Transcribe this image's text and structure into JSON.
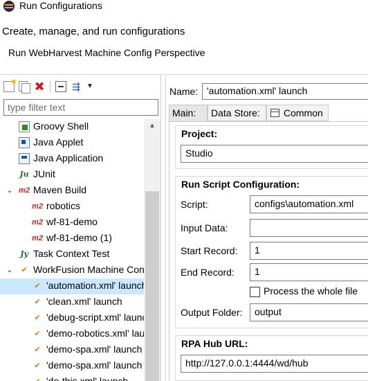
{
  "window": {
    "title": "Run Configurations"
  },
  "header": {
    "heading": "Create, manage, and run configurations",
    "subheading": "Run WebHarvest Machine Config Perspective"
  },
  "toolbar": {
    "new_icon": "new-config-icon",
    "duplicate_icon": "duplicate-icon",
    "delete_icon": "delete-icon",
    "collapse_icon": "collapse-all-icon",
    "filter_icon": "filter-icon",
    "menu_icon": "view-menu-icon",
    "delete_glyph": "✖",
    "filter_glyph": "⇶",
    "menu_glyph": "▼"
  },
  "filter": {
    "placeholder": "type filter text"
  },
  "tree": {
    "items": [
      {
        "label": "Groovy Shell",
        "level": 1,
        "icon": "groovy-icon",
        "expanded": null,
        "selected": false
      },
      {
        "label": "Java Applet",
        "level": 1,
        "icon": "java-applet-icon",
        "expanded": null,
        "selected": false
      },
      {
        "label": "Java Application",
        "level": 1,
        "icon": "java-app-icon",
        "expanded": null,
        "selected": false
      },
      {
        "label": "JUnit",
        "level": 1,
        "icon": "junit-icon",
        "expanded": null,
        "selected": false
      },
      {
        "label": "Maven Build",
        "level": 1,
        "icon": "maven-icon",
        "expanded": true,
        "selected": false
      },
      {
        "label": "robotics",
        "level": 2,
        "icon": "maven-icon",
        "expanded": null,
        "selected": false
      },
      {
        "label": "wf-81-demo",
        "level": 2,
        "icon": "maven-icon",
        "expanded": null,
        "selected": false
      },
      {
        "label": "wf-81-demo (1)",
        "level": 2,
        "icon": "maven-icon",
        "expanded": null,
        "selected": false
      },
      {
        "label": "Task Context Test",
        "level": 1,
        "icon": "task-context-icon",
        "expanded": null,
        "selected": false
      },
      {
        "label": "WorkFusion Machine Config",
        "level": 1,
        "icon": "workfusion-icon",
        "expanded": true,
        "selected": false
      },
      {
        "label": "'automation.xml' launch",
        "level": 2,
        "icon": "workfusion-icon",
        "expanded": null,
        "selected": true
      },
      {
        "label": "'clean.xml' launch",
        "level": 2,
        "icon": "workfusion-icon",
        "expanded": null,
        "selected": false
      },
      {
        "label": "'debug-script.xml' launch",
        "level": 2,
        "icon": "workfusion-icon",
        "expanded": null,
        "selected": false
      },
      {
        "label": "'demo-robotics.xml' launch",
        "level": 2,
        "icon": "workfusion-icon",
        "expanded": null,
        "selected": false
      },
      {
        "label": "'demo-spa.xml' launch",
        "level": 2,
        "icon": "workfusion-icon",
        "expanded": null,
        "selected": false
      },
      {
        "label": "'demo-spa.xml' launch",
        "level": 2,
        "icon": "workfusion-icon",
        "expanded": null,
        "selected": false
      },
      {
        "label": "'do-this.xml' launch",
        "level": 2,
        "icon": "workfusion-icon",
        "expanded": null,
        "selected": false
      }
    ]
  },
  "editor": {
    "name_label": "Name:",
    "name_value": "'automation.xml' launch",
    "tabs": [
      {
        "label": "Main:",
        "active": true
      },
      {
        "label": "Data Store:",
        "active": false
      },
      {
        "label": "Common",
        "active": false,
        "icon": "common-tab-icon"
      }
    ],
    "project": {
      "title": "Project:",
      "value": "Studio"
    },
    "run_script": {
      "title": "Run Script Configuration:",
      "script_label": "Script:",
      "script_value": "configs\\automation.xml",
      "input_label": "Input Data:",
      "input_value": "",
      "start_label": "Start Record:",
      "start_value": "1",
      "end_label": "End Record:",
      "end_value": "1",
      "whole_file_label": "Process the whole file",
      "whole_file_checked": false,
      "output_label": "Output Folder:",
      "output_value": "output"
    },
    "rpa_hub": {
      "title": "RPA Hub URL:",
      "value": "http://127.0.0.1:4444/wd/hub"
    }
  }
}
